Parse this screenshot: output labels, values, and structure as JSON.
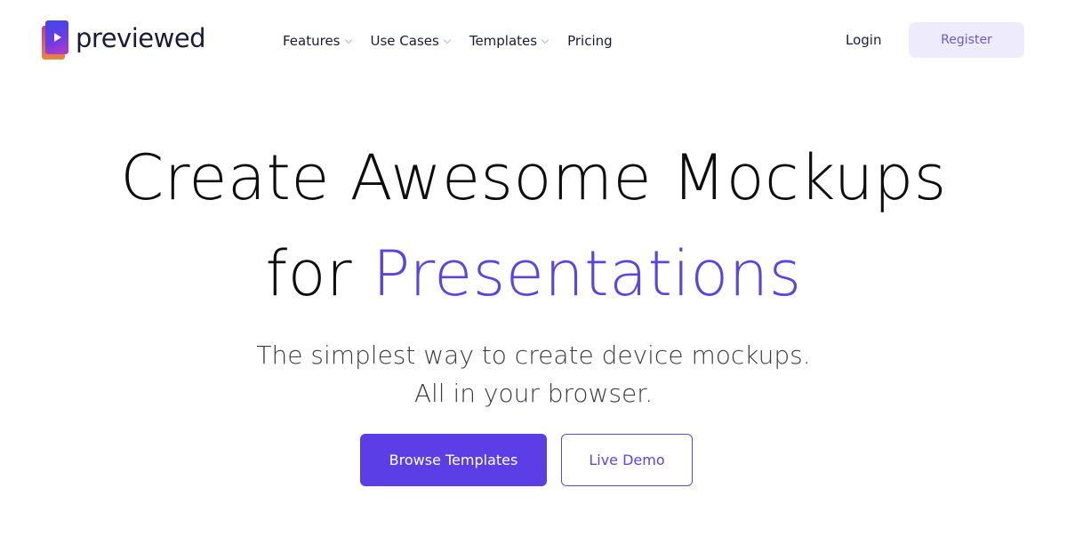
{
  "brand": {
    "name": "previewed",
    "logo_icon": "play-icon"
  },
  "nav": {
    "items": [
      {
        "label": "Features",
        "has_dropdown": true
      },
      {
        "label": "Use Cases",
        "has_dropdown": true
      },
      {
        "label": "Templates",
        "has_dropdown": true
      },
      {
        "label": "Pricing",
        "has_dropdown": false
      }
    ],
    "login_label": "Login",
    "register_label": "Register"
  },
  "hero": {
    "title_line1": "Create Awesome Mockups",
    "title_line2_prefix": "for ",
    "title_line2_accent": "Presentations",
    "subtitle_line1": "The simplest way to create device mockups.",
    "subtitle_line2": "All in your browser.",
    "primary_cta": "Browse Templates",
    "secondary_cta": "Live Demo"
  },
  "colors": {
    "accent": "#5b45e0",
    "primary_button": "#5b3ee6",
    "register_bg": "#eeebfd",
    "text_dark": "#1b1a3a"
  }
}
